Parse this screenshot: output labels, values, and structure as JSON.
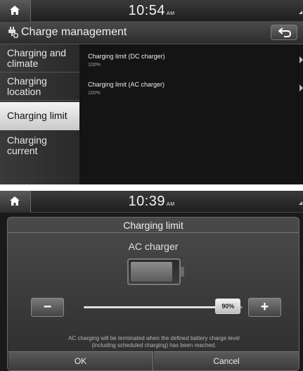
{
  "screen1": {
    "status": {
      "time": "10:54",
      "ampm": "AM"
    },
    "title": "Charge management",
    "sidebar": {
      "items": [
        {
          "label": "Charging and climate",
          "active": false
        },
        {
          "label": "Charging location",
          "active": false
        },
        {
          "label": "Charging limit",
          "active": true
        },
        {
          "label": "Charging current",
          "active": false
        }
      ]
    },
    "list": {
      "items": [
        {
          "title": "Charging limit (DC charger)",
          "value": "100%"
        },
        {
          "title": "Charging limit (AC charger)",
          "value": "100%"
        }
      ]
    }
  },
  "screen2": {
    "status": {
      "time": "10:39",
      "ampm": "AM"
    },
    "title": "Charging limit",
    "subtitle": "AC charger",
    "battery_level": 0.9,
    "minus_label": "−",
    "plus_label": "+",
    "slider": {
      "value_label": "90%",
      "value": 0.9
    },
    "note_line1": "AC charging will be terminated when the defined battery charge level",
    "note_line2": "(including scheduled charging) has been reached.",
    "ok_label": "OK",
    "cancel_label": "Cancel"
  },
  "icons": {
    "home": "home-icon",
    "back": "back-arrow-icon",
    "settings": "charge-settings-icon",
    "battery": "battery-icon"
  }
}
